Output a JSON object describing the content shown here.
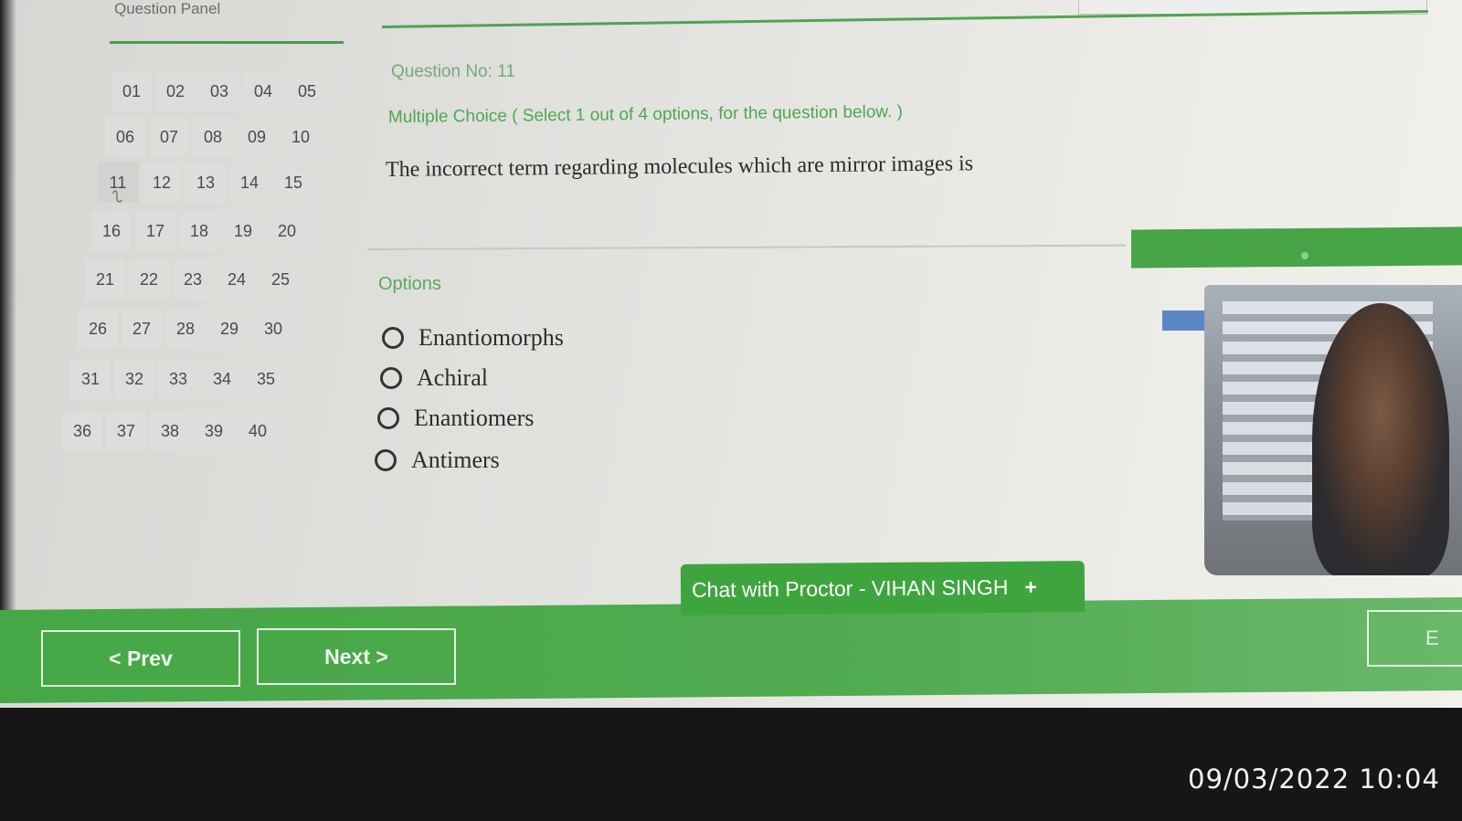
{
  "panel": {
    "title": "Question Panel",
    "rows": [
      [
        "01",
        "02",
        "03",
        "04",
        "05"
      ],
      [
        "06",
        "07",
        "08",
        "09",
        "10"
      ],
      [
        "11",
        "12",
        "13",
        "14",
        "15"
      ],
      [
        "16",
        "17",
        "18",
        "19",
        "20"
      ],
      [
        "21",
        "22",
        "23",
        "24",
        "25"
      ],
      [
        "26",
        "27",
        "28",
        "29",
        "30"
      ],
      [
        "31",
        "32",
        "33",
        "34",
        "35"
      ],
      [
        "36",
        "37",
        "38",
        "39",
        "40"
      ]
    ],
    "current": "11"
  },
  "question": {
    "number_label": "Question No: 11",
    "type_label": "Multiple Choice ( Select 1 out of 4 options, for the question below. )",
    "text": "The incorrect term regarding molecules which are mirror images is"
  },
  "options": {
    "label": "Options",
    "items": [
      "Enantiomorphs",
      "Achiral",
      "Enantiomers",
      "Antimers"
    ]
  },
  "nav": {
    "prev_label": "< Prev",
    "next_label": "Next >",
    "end_label": "E"
  },
  "chat": {
    "label": "Chat with Proctor - VIHAN SINGH",
    "plus": "+"
  },
  "photo": {
    "timestamp": "09/03/2022 10:04"
  },
  "colors": {
    "accent": "#4aa84a",
    "panel_bg": "#e3e3e0"
  }
}
